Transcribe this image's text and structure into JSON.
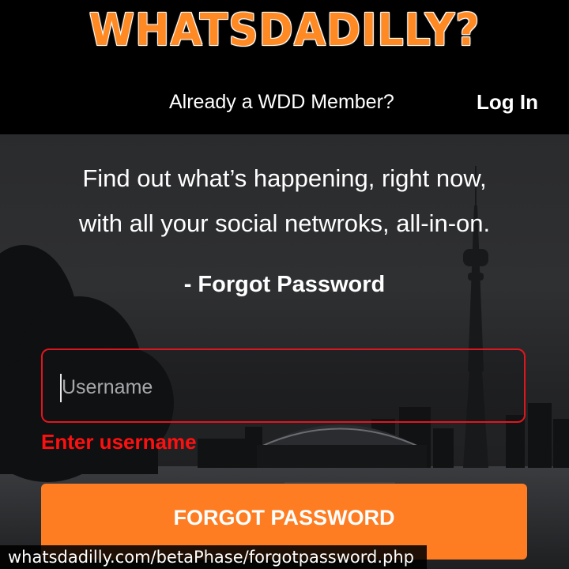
{
  "header": {
    "logo_text": "WHATSDADILLY?",
    "member_prompt": "Already a WDD Member?",
    "login_label": "Log In"
  },
  "hero": {
    "tagline_line1": "Find out what’s happening, right now,",
    "tagline_line2": "with all your social netwroks, all-in-on.",
    "subtitle": "- Forgot Password"
  },
  "form": {
    "username_placeholder": "Username",
    "username_value": "",
    "error_text": "Enter username",
    "submit_label": "FORGOT PASSWORD"
  },
  "browser": {
    "url": "whatsdadilly.com/betaPhase/forgotpassword.php"
  },
  "colors": {
    "accent_orange": "#ff7d22",
    "error_red": "#ff1010",
    "input_border": "#e0161e",
    "header_bg": "#000000"
  }
}
